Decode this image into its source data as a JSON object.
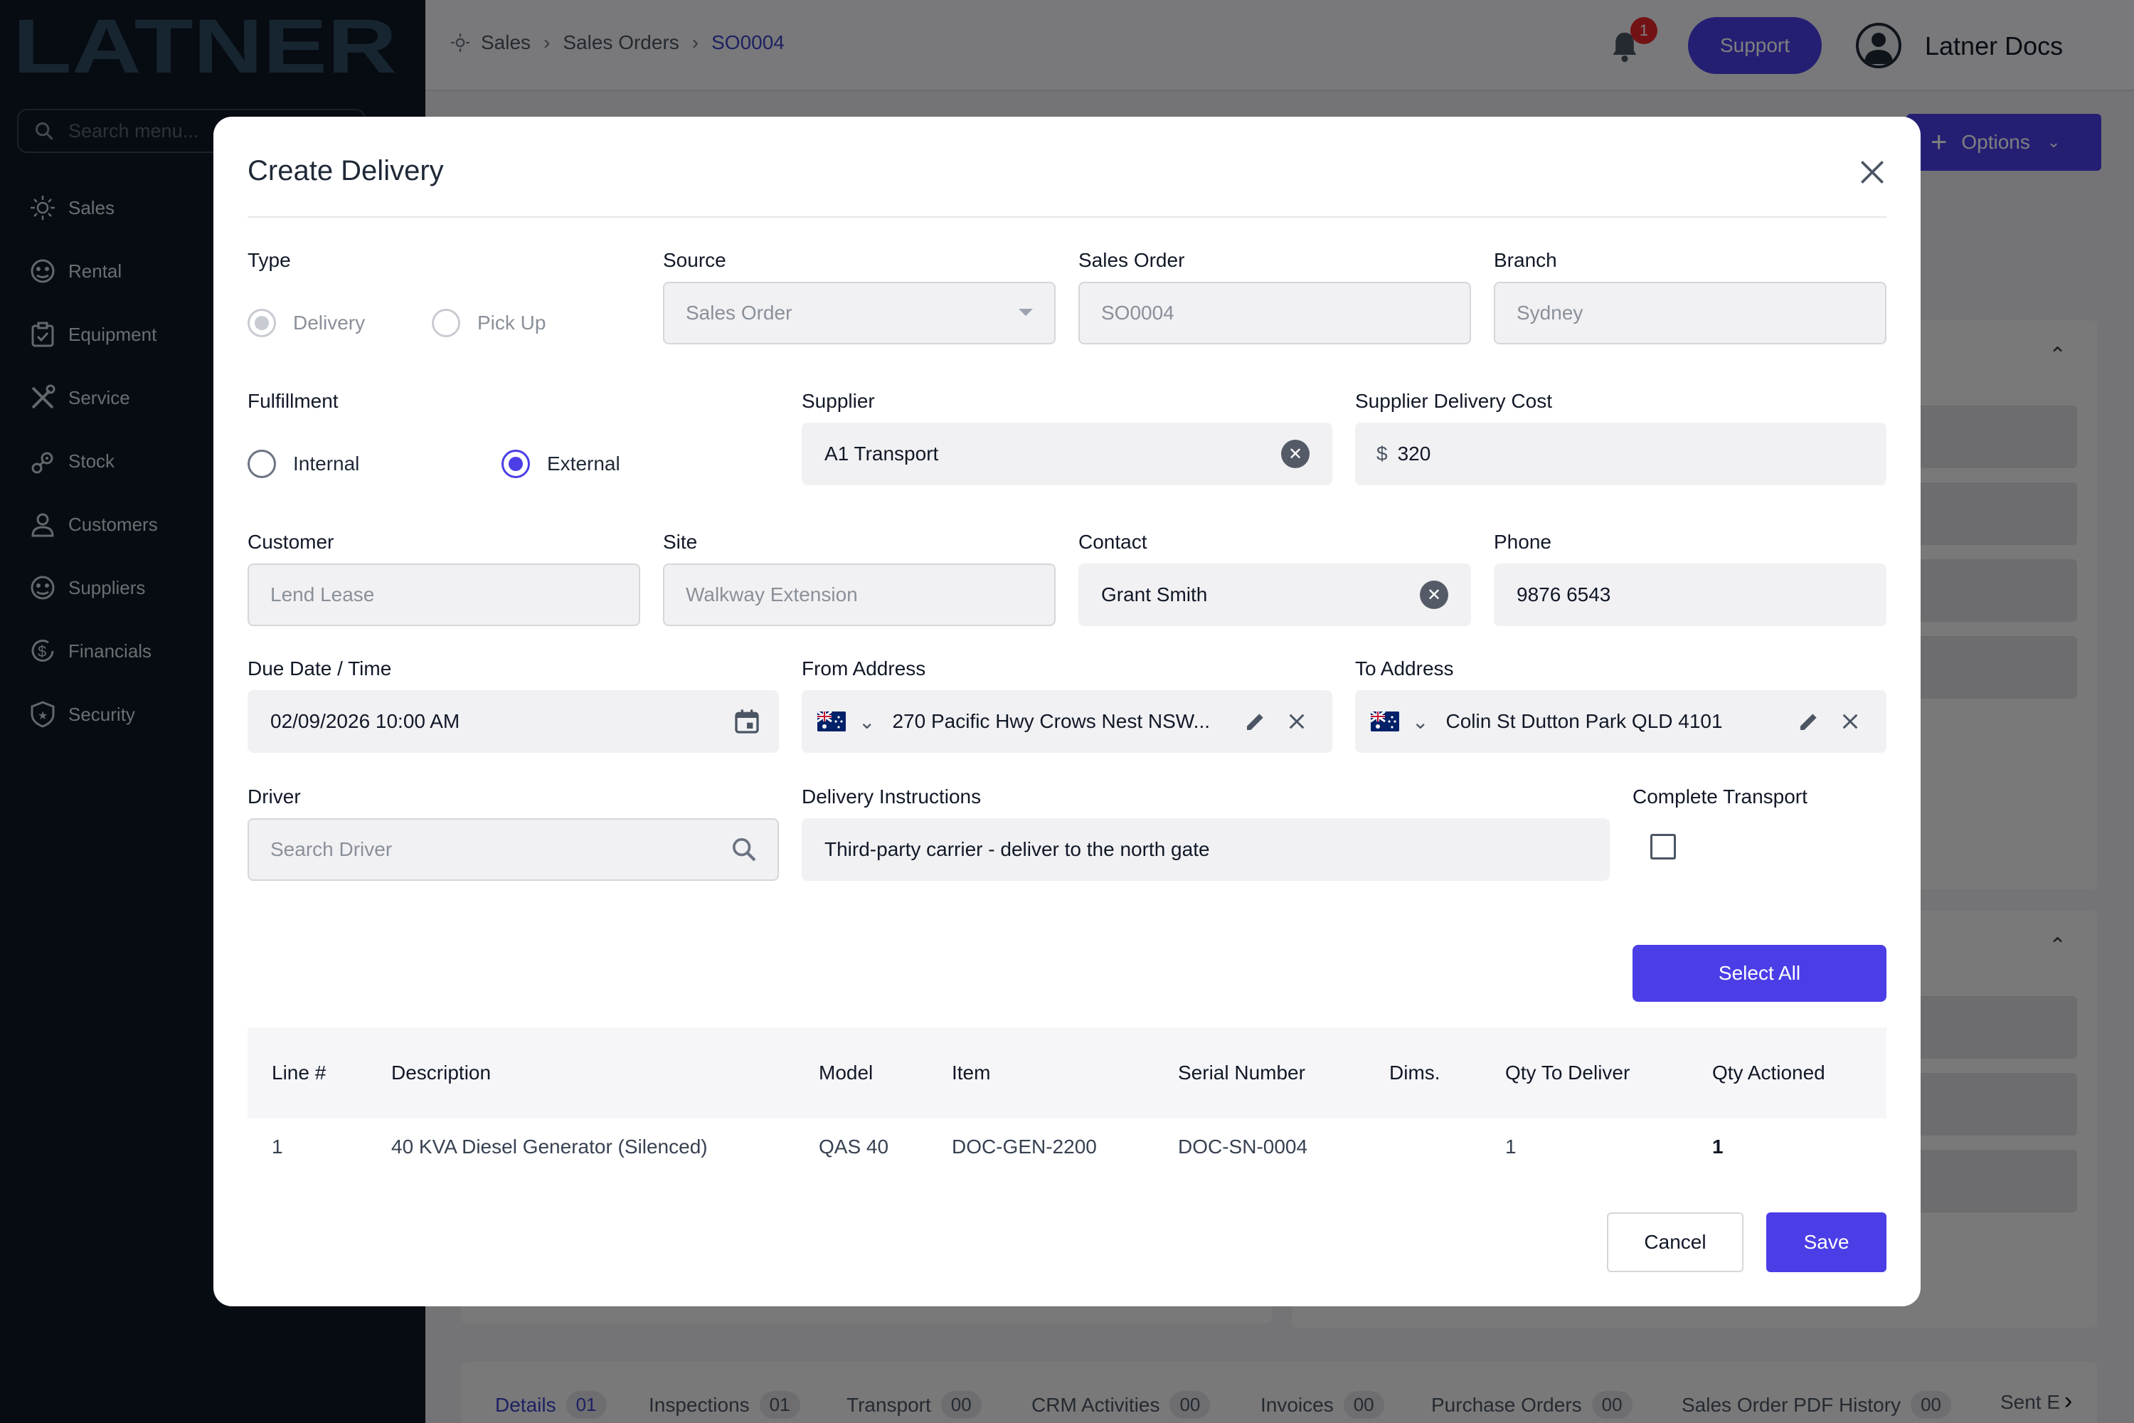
{
  "app": {
    "logo": "LATNER"
  },
  "sidebar": {
    "search_placeholder": "Search menu...",
    "items": [
      {
        "label": "Sales",
        "icon": "sales-icon"
      },
      {
        "label": "Rental",
        "icon": "rental-icon"
      },
      {
        "label": "Equipment",
        "icon": "equipment-icon"
      },
      {
        "label": "Service",
        "icon": "service-icon"
      },
      {
        "label": "Stock",
        "icon": "stock-icon"
      },
      {
        "label": "Customers",
        "icon": "customers-icon"
      },
      {
        "label": "Suppliers",
        "icon": "suppliers-icon"
      },
      {
        "label": "Financials",
        "icon": "financials-icon"
      },
      {
        "label": "Security",
        "icon": "security-icon"
      }
    ]
  },
  "header": {
    "breadcrumb": [
      "Sales",
      "Sales Orders",
      "SO0004"
    ],
    "notification_count": "1",
    "support_label": "Support",
    "user_name": "Latner Docs",
    "options_label": "Options"
  },
  "bottom_tabs": [
    {
      "label": "Details",
      "count": "01"
    },
    {
      "label": "Inspections",
      "count": "01"
    },
    {
      "label": "Transport",
      "count": "00"
    },
    {
      "label": "CRM Activities",
      "count": "00"
    },
    {
      "label": "Invoices",
      "count": "00"
    },
    {
      "label": "Purchase Orders",
      "count": "00"
    },
    {
      "label": "Sales Order PDF History",
      "count": "00"
    },
    {
      "label": "Sent E",
      "count": ""
    }
  ],
  "modal": {
    "title": "Create Delivery",
    "type": {
      "label": "Type",
      "options": [
        "Delivery",
        "Pick Up"
      ],
      "selected": "Delivery"
    },
    "source": {
      "label": "Source",
      "value": "Sales Order"
    },
    "sales_order": {
      "label": "Sales Order",
      "value": "SO0004"
    },
    "branch": {
      "label": "Branch",
      "value": "Sydney"
    },
    "fulfillment": {
      "label": "Fulfillment",
      "options": [
        "Internal",
        "External"
      ],
      "selected": "External"
    },
    "supplier": {
      "label": "Supplier",
      "value": "A1 Transport"
    },
    "supplier_cost": {
      "label": "Supplier Delivery Cost",
      "currency": "$",
      "value": "320"
    },
    "customer": {
      "label": "Customer",
      "value": "Lend Lease"
    },
    "site": {
      "label": "Site",
      "value": "Walkway Extension"
    },
    "contact": {
      "label": "Contact",
      "value": "Grant Smith"
    },
    "phone": {
      "label": "Phone",
      "value": "9876 6543"
    },
    "due_date": {
      "label": "Due Date / Time",
      "value": "02/09/2026 10:00 AM"
    },
    "from_address": {
      "label": "From Address",
      "value": "270 Pacific Hwy Crows Nest NSW..."
    },
    "to_address": {
      "label": "To Address",
      "value": "Colin St Dutton Park QLD 4101"
    },
    "driver": {
      "label": "Driver",
      "placeholder": "Search Driver"
    },
    "instructions": {
      "label": "Delivery Instructions",
      "value": "Third-party carrier - deliver to the north gate"
    },
    "complete_transport": {
      "label": "Complete Transport",
      "checked": false
    },
    "select_all_label": "Select All",
    "table": {
      "headers": [
        "Line #",
        "Description",
        "Model",
        "Item",
        "Serial Number",
        "Dims.",
        "Qty To Deliver",
        "Qty Actioned"
      ],
      "rows": [
        [
          "1",
          "40 KVA Diesel Generator (Silenced)",
          "QAS 40",
          "DOC-GEN-2200",
          "DOC-SN-0004",
          "",
          "1",
          "1"
        ]
      ]
    },
    "cancel_label": "Cancel",
    "save_label": "Save"
  },
  "colors": {
    "primary": "#4b3ee6",
    "sidebar_bg": "#0e1624",
    "badge": "#e5242b"
  }
}
